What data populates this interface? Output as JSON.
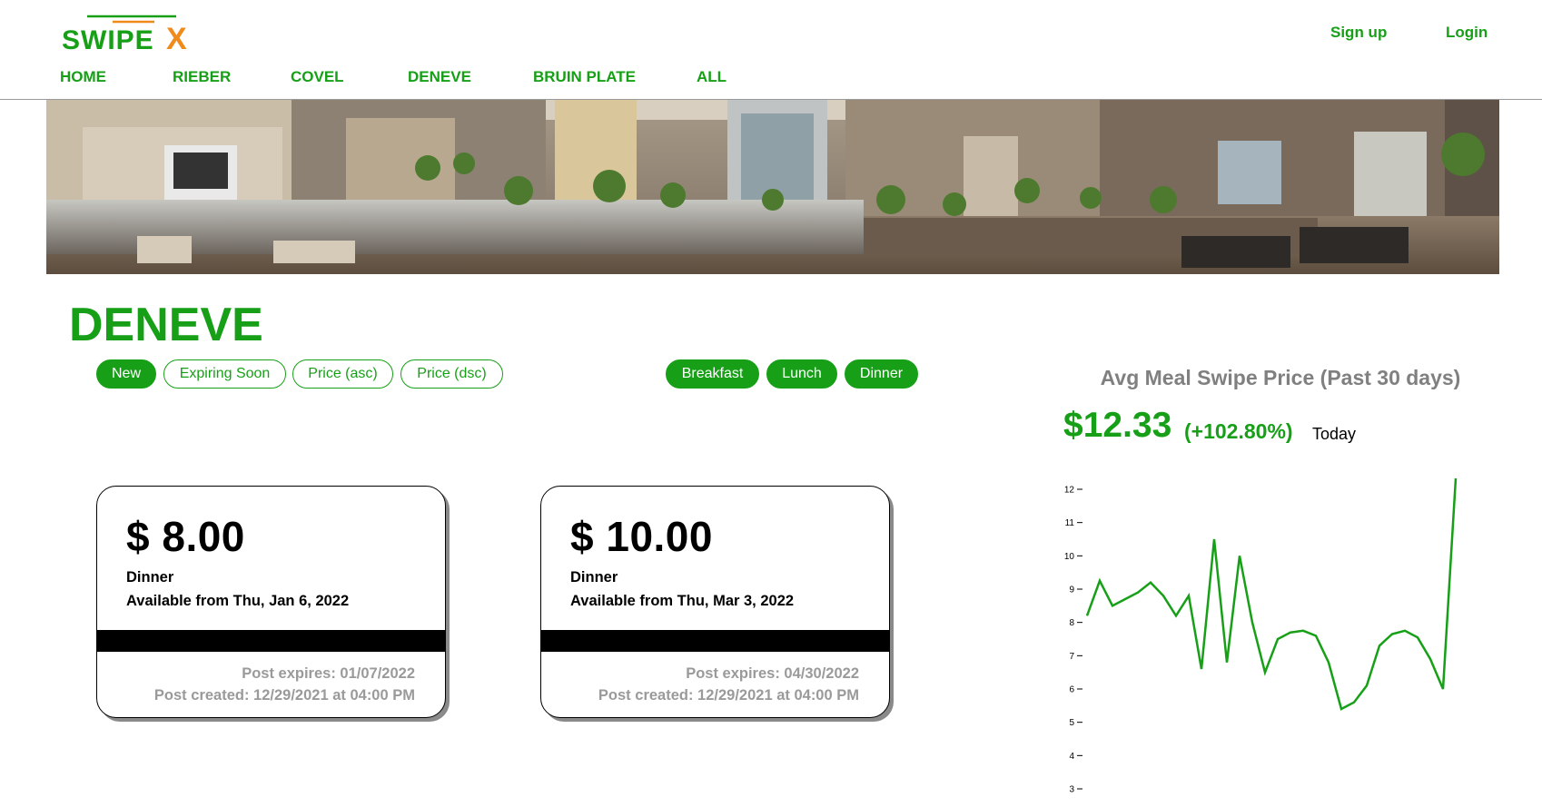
{
  "brand": {
    "name": "SWIPEX",
    "letters_main": "SWIPE",
    "letter_x": "X",
    "color_green": "#17a017",
    "color_orange": "#f08a1a"
  },
  "header": {
    "auth": {
      "signup_label": "Sign up",
      "login_label": "Login"
    },
    "nav": [
      "HOME",
      "RIEBER",
      "COVEL",
      "DENEVE",
      "BRUIN PLATE",
      "ALL"
    ]
  },
  "banner": {
    "image": "dining-hall-photo"
  },
  "page": {
    "title": "DENEVE"
  },
  "sort_filters": [
    {
      "label": "New",
      "active": true
    },
    {
      "label": "Expiring Soon",
      "active": false
    },
    {
      "label": "Price (asc)",
      "active": false
    },
    {
      "label": "Price (dsc)",
      "active": false
    }
  ],
  "meal_filters": [
    {
      "label": "Breakfast",
      "active": true
    },
    {
      "label": "Lunch",
      "active": true
    },
    {
      "label": "Dinner",
      "active": true
    }
  ],
  "listings": [
    {
      "price": "$ 8.00",
      "meal": "Dinner",
      "available": "Available from Thu, Jan 6, 2022",
      "expires": "Post expires: 01/07/2022",
      "created": "Post created: 12/29/2021 at 04:00 PM"
    },
    {
      "price": "$ 10.00",
      "meal": "Dinner",
      "available": "Available from Thu, Mar 3, 2022",
      "expires": "Post expires: 04/30/2022",
      "created": "Post created: 12/29/2021 at 04:00 PM"
    }
  ],
  "stats": {
    "title": "Avg Meal Swipe Price (Past 30 days)",
    "price": "$12.33",
    "change": "(+102.80%)",
    "today": "Today"
  },
  "chart_data": {
    "type": "line",
    "y_ticks": [
      3,
      4,
      5,
      6,
      7,
      8,
      9,
      10,
      11,
      12
    ],
    "ylim": [
      3,
      12.3
    ],
    "grid": false,
    "line_color": "#17a017",
    "series": [
      {
        "values": [
          8.2,
          9.25,
          8.5,
          8.7,
          8.9,
          9.2,
          8.8,
          8.2,
          8.8,
          6.6,
          10.5,
          6.8,
          10.0,
          8.0,
          6.5,
          7.5,
          7.7,
          7.75,
          7.6,
          6.8,
          5.4,
          5.6,
          6.1,
          7.3,
          7.65,
          7.75,
          7.55,
          6.9,
          6.0,
          12.33
        ]
      }
    ]
  }
}
